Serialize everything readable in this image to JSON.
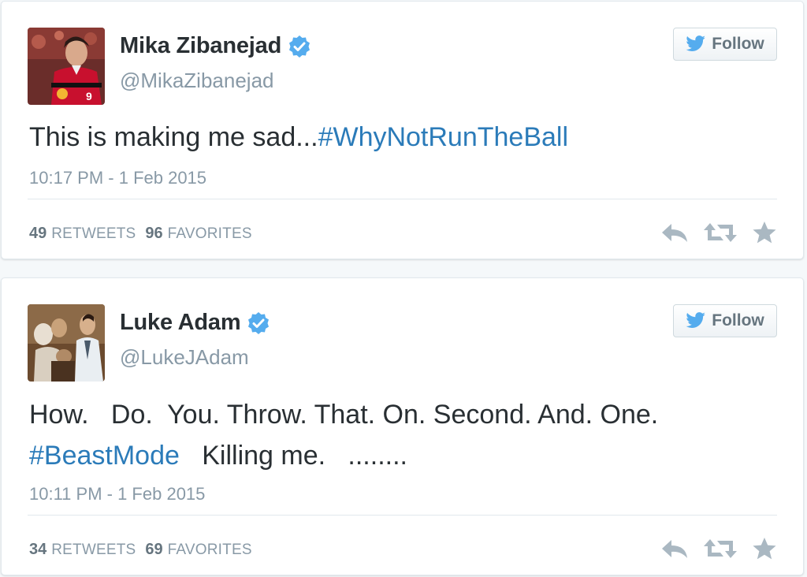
{
  "tweets": [
    {
      "name": "Mika Zibanejad",
      "handle": "@MikaZibanejad",
      "follow_label": "Follow",
      "text_plain": "This is making me sad...",
      "hashtag": "#WhyNotRunTheBall",
      "time": "10:17 PM - 1 Feb 2015",
      "retweets": "49",
      "retweets_label": "RETWEETS",
      "favorites": "96",
      "favorites_label": "FAVORITES",
      "avatar_icon": "hockey-player-photo",
      "verified_icon": "verified-badge-icon"
    },
    {
      "name": "Luke Adam",
      "handle": "@LukeJAdam",
      "follow_label": "Follow",
      "text_line1": "How.   Do.  You. Throw. That. On. Second. And. One.",
      "hashtag": "#BeastMode",
      "text_after": "   Killing me.   ........",
      "time": "10:11 PM - 1 Feb 2015",
      "retweets": "34",
      "retweets_label": "RETWEETS",
      "favorites": "69",
      "favorites_label": "FAVORITES",
      "avatar_icon": "group-photo",
      "verified_icon": "verified-badge-icon"
    }
  ],
  "colors": {
    "link": "#2b7bb9",
    "verified": "#55acee",
    "muted": "#8899a6",
    "twitter_bird": "#55acee"
  }
}
